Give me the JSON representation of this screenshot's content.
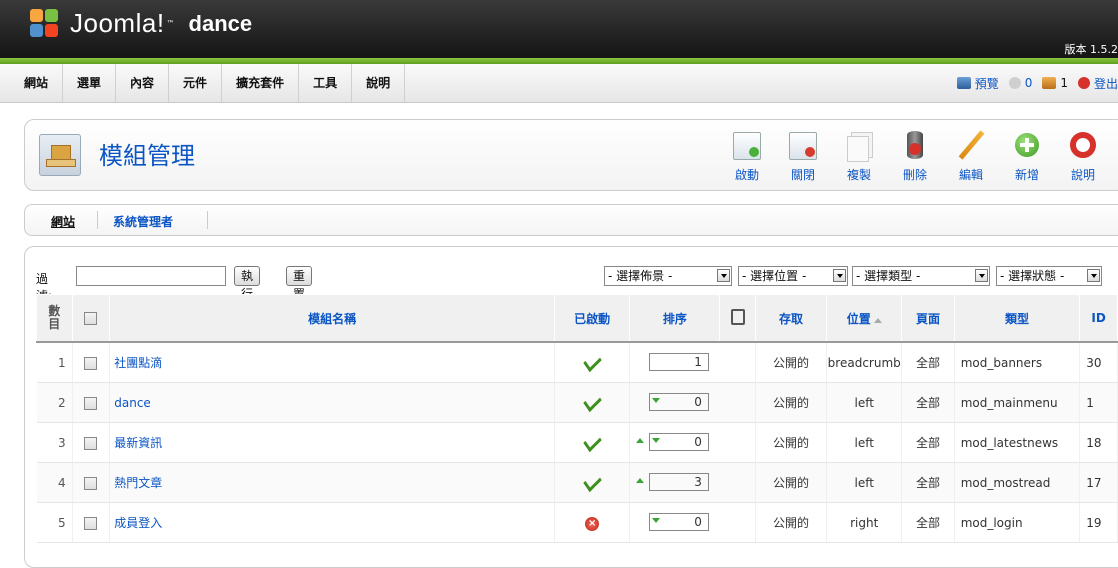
{
  "header": {
    "logo_text": "Joomla!",
    "site_name": "dance",
    "version": "版本 1.5.2"
  },
  "menu": [
    "網站",
    "選單",
    "內容",
    "元件",
    "擴充套件",
    "工具",
    "說明"
  ],
  "status": {
    "preview": "預覽",
    "messages": "0",
    "users": "1",
    "logout": "登出"
  },
  "page": {
    "title": "模組管理"
  },
  "toolbar": [
    {
      "label": "啟動",
      "icon": "publish-icon"
    },
    {
      "label": "關閉",
      "icon": "unpublish-icon"
    },
    {
      "label": "複製",
      "icon": "copy-icon"
    },
    {
      "label": "刪除",
      "icon": "delete-icon"
    },
    {
      "label": "編輯",
      "icon": "edit-icon"
    },
    {
      "label": "新增",
      "icon": "new-icon"
    },
    {
      "label": "說明",
      "icon": "help-icon"
    }
  ],
  "submenu": {
    "site": "網站",
    "admin": "系統管理者"
  },
  "filter": {
    "label": "過濾:",
    "value": "",
    "go": "執行",
    "reset": "重置",
    "template": "- 選擇佈景 -",
    "position": "- 選擇位置 -",
    "type": "- 選擇類型 -",
    "state": "- 選擇狀態 -"
  },
  "columns": {
    "num": "數目",
    "name": "模組名稱",
    "enabled": "已啟動",
    "order": "排序",
    "access": "存取",
    "position": "位置",
    "pages": "頁面",
    "type": "類型",
    "id": "ID"
  },
  "rows": [
    {
      "num": "1",
      "name": "社團點滴",
      "enabled": true,
      "up": false,
      "down": false,
      "order": "1",
      "access": "公開的",
      "position": "breadcrumb",
      "pages": "全部",
      "type": "mod_banners",
      "id": "30"
    },
    {
      "num": "2",
      "name": "dance",
      "enabled": true,
      "up": false,
      "down": true,
      "order": "0",
      "access": "公開的",
      "position": "left",
      "pages": "全部",
      "type": "mod_mainmenu",
      "id": "1"
    },
    {
      "num": "3",
      "name": "最新資訊",
      "enabled": true,
      "up": true,
      "down": true,
      "order": "0",
      "access": "公開的",
      "position": "left",
      "pages": "全部",
      "type": "mod_latestnews",
      "id": "18"
    },
    {
      "num": "4",
      "name": "熱門文章",
      "enabled": true,
      "up": true,
      "down": false,
      "order": "3",
      "access": "公開的",
      "position": "left",
      "pages": "全部",
      "type": "mod_mostread",
      "id": "17"
    },
    {
      "num": "5",
      "name": "成員登入",
      "enabled": false,
      "up": false,
      "down": true,
      "order": "0",
      "access": "公開的",
      "position": "right",
      "pages": "全部",
      "type": "mod_login",
      "id": "19"
    }
  ]
}
